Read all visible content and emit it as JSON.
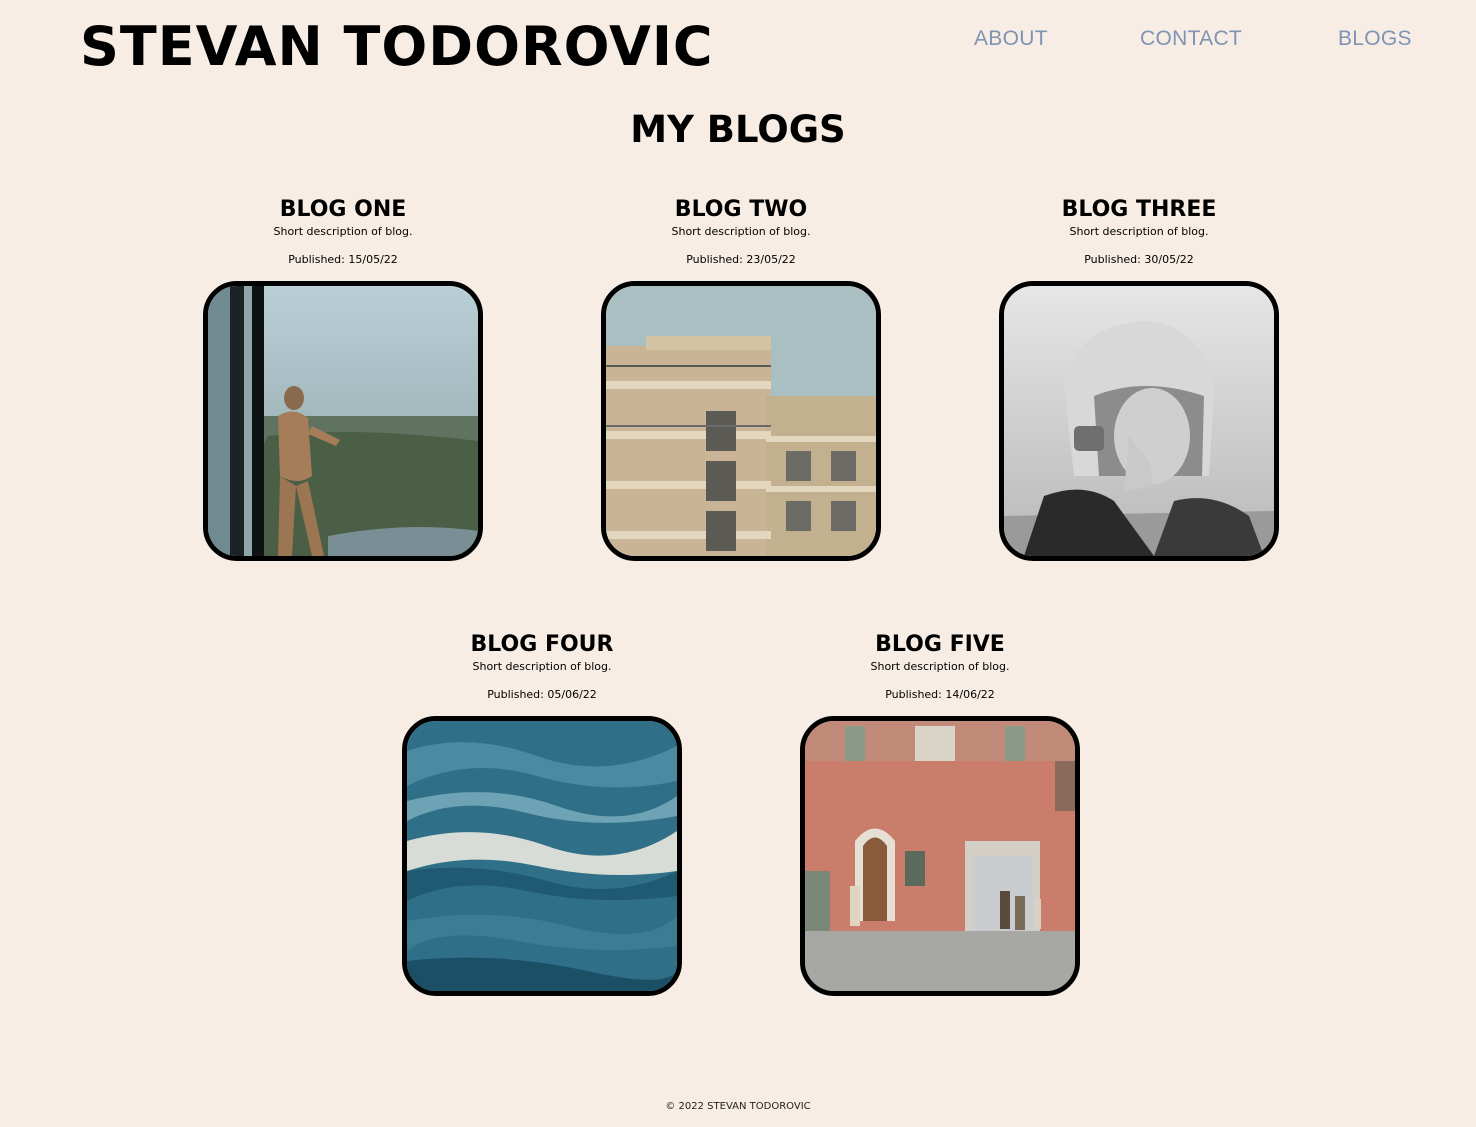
{
  "header": {
    "site_title": "STEVAN TODOROVIC",
    "nav": [
      {
        "label": "ABOUT"
      },
      {
        "label": "CONTACT"
      },
      {
        "label": "BLOGS"
      }
    ]
  },
  "main": {
    "section_title": "MY BLOGS",
    "blogs": [
      {
        "title": "BLOG ONE",
        "description": "Short description of blog.",
        "published": "Published: 15/05/22",
        "image": "woman-at-window-photo"
      },
      {
        "title": "BLOG TWO",
        "description": "Short description of blog.",
        "published": "Published: 23/05/22",
        "image": "apartment-building-photo"
      },
      {
        "title": "BLOG THREE",
        "description": "Short description of blog.",
        "published": "Published: 30/05/22",
        "image": "astronaut-helmet-photo"
      },
      {
        "title": "BLOG FOUR",
        "description": "Short description of blog.",
        "published": "Published: 05/06/22",
        "image": "ocean-waves-photo"
      },
      {
        "title": "BLOG FIVE",
        "description": "Short description of blog.",
        "published": "Published: 14/06/22",
        "image": "hotel-sole-street-photo"
      }
    ]
  },
  "footer": {
    "copyright": "© 2022 STEVAN TODOROVIC"
  },
  "colors": {
    "background": "#f7ede4",
    "nav_link": "#7f93b3",
    "text": "#000000"
  }
}
